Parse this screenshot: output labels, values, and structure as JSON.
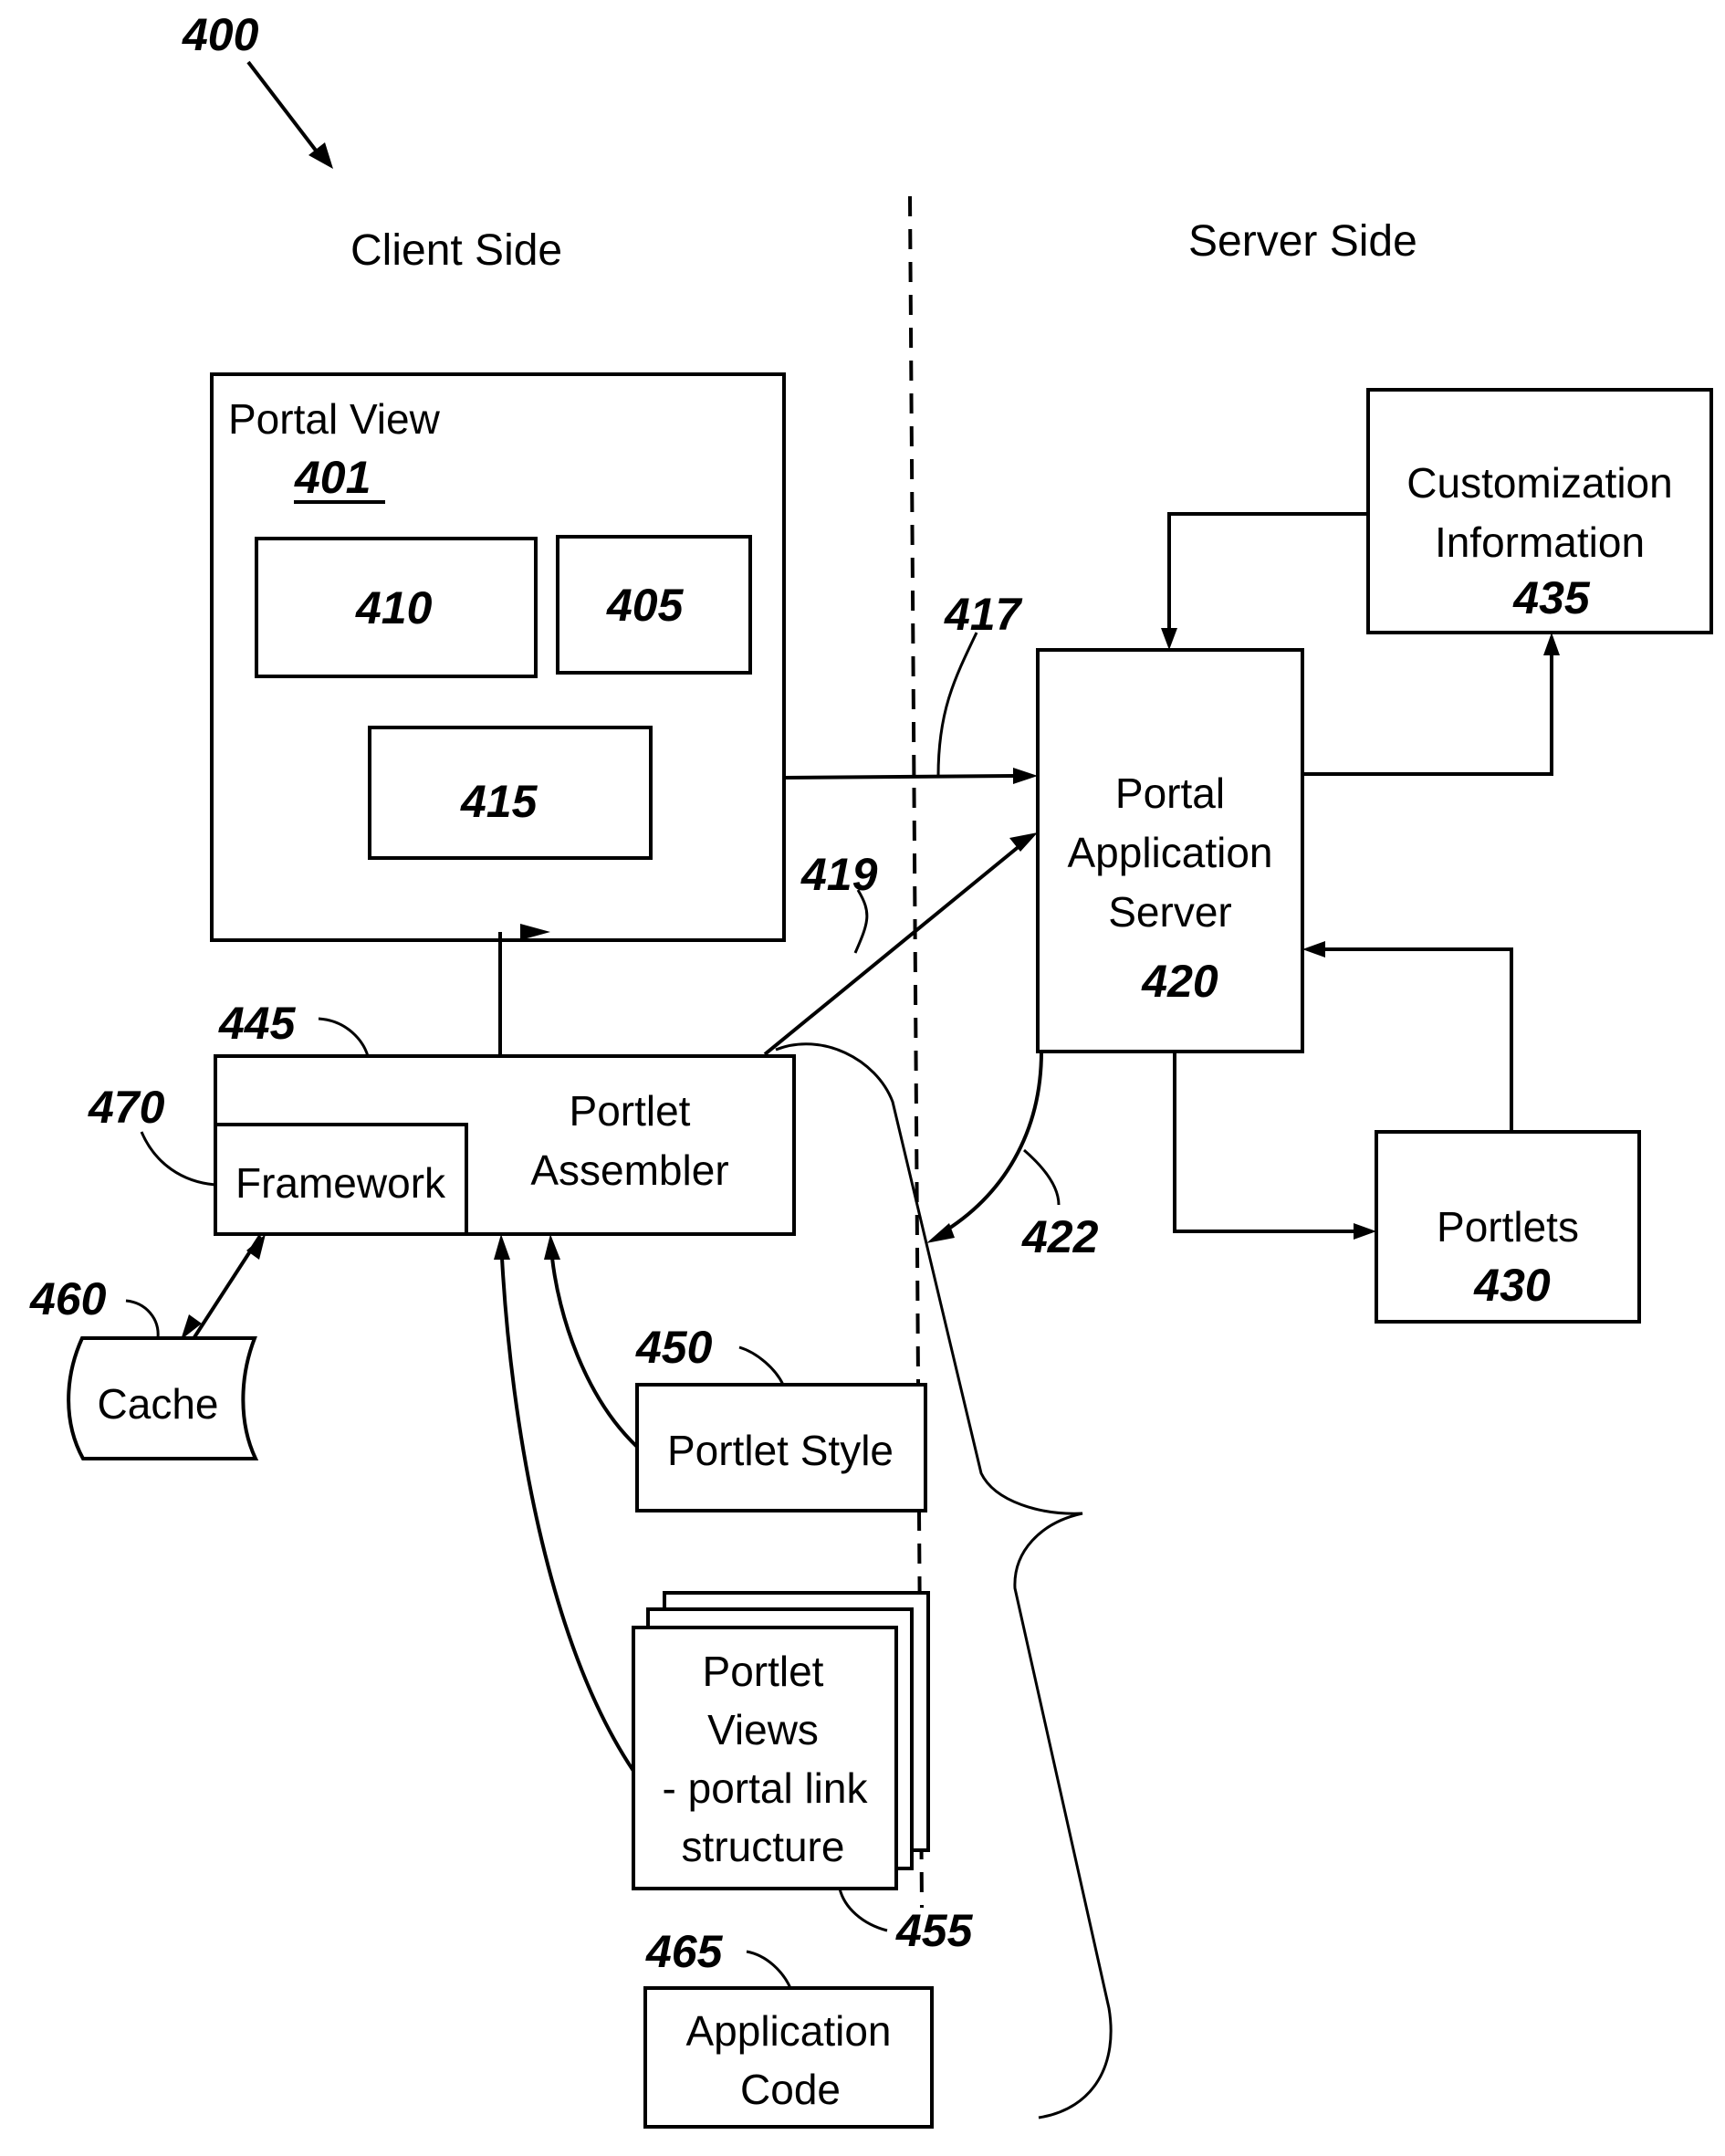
{
  "figure": {
    "ref": "400",
    "client_side_label": "Client Side",
    "server_side_label": "Server Side"
  },
  "portal_view": {
    "title": "Portal View",
    "ref": "401",
    "sub_boxes": [
      {
        "ref": "410"
      },
      {
        "ref": "405"
      },
      {
        "ref": "415"
      }
    ]
  },
  "portal_application_server": {
    "lines": [
      "Portal",
      "Application",
      "Server"
    ],
    "ref": "420"
  },
  "customization_information": {
    "lines": [
      "Customization",
      "Information"
    ],
    "ref": "435"
  },
  "portlets": {
    "lines": [
      "Portlets"
    ],
    "ref": "430"
  },
  "portlet_assembler": {
    "lines": [
      "Portlet",
      "Assembler"
    ],
    "ref": "445"
  },
  "framework": {
    "label": "Framework",
    "ref": "470"
  },
  "cache": {
    "label": "Cache",
    "ref": "460"
  },
  "portlet_style": {
    "label": "Portlet Style",
    "ref": "450"
  },
  "portlet_views": {
    "lines": [
      "Portlet",
      "Views",
      "- portal link",
      "structure"
    ],
    "ref": "455"
  },
  "application_code": {
    "lines": [
      "Application",
      "Code"
    ],
    "ref": "465"
  },
  "connections": {
    "portal_view_to_server": "417",
    "assembler_to_server": "419",
    "server_to_client": "422"
  }
}
